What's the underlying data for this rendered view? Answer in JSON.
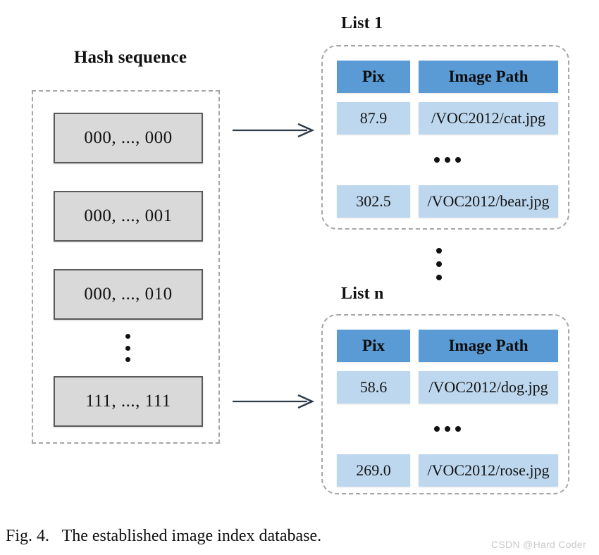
{
  "figure": {
    "caption": "Fig. 4.   The established image index database.",
    "watermark": "CSDN @Hard Coder"
  },
  "hash_section": {
    "title": "Hash sequence",
    "boxes": [
      {
        "label": "000, ..., 000"
      },
      {
        "label": "000, ..., 001"
      },
      {
        "label": "000, ..., 010"
      },
      {
        "label": "111, ..., 111"
      }
    ],
    "ellipsis": "vertical-ellipsis"
  },
  "arrows": [
    {
      "name": "arrow-hash-to-list1",
      "direction": "right"
    },
    {
      "name": "arrow-hash-to-listn",
      "direction": "right"
    }
  ],
  "between_lists_ellipsis": "vertical-ellipsis",
  "lists": [
    {
      "label": "List 1",
      "columns": [
        "Pix",
        "Image Path"
      ],
      "rows": [
        {
          "pix": "87.9",
          "path": "/VOC2012/cat.jpg"
        },
        {
          "pix": "302.5",
          "path": "/VOC2012/bear.jpg"
        }
      ],
      "row_ellipsis": "horizontal-ellipsis"
    },
    {
      "label": "List n",
      "columns": [
        "Pix",
        "Image Path"
      ],
      "rows": [
        {
          "pix": "58.6",
          "path": "/VOC2012/dog.jpg"
        },
        {
          "pix": "269.0",
          "path": "/VOC2012/rose.jpg"
        }
      ],
      "row_ellipsis": "horizontal-ellipsis"
    }
  ],
  "colors": {
    "header_blue": "#5B9BD5",
    "row_blue": "#BDD7EE",
    "hash_box_gray": "#D9D9D9",
    "hash_box_border": "#5A5A5A",
    "dashed_border": "#A6A6A6",
    "text": "#111111",
    "watermark": "#C9C9C9"
  }
}
